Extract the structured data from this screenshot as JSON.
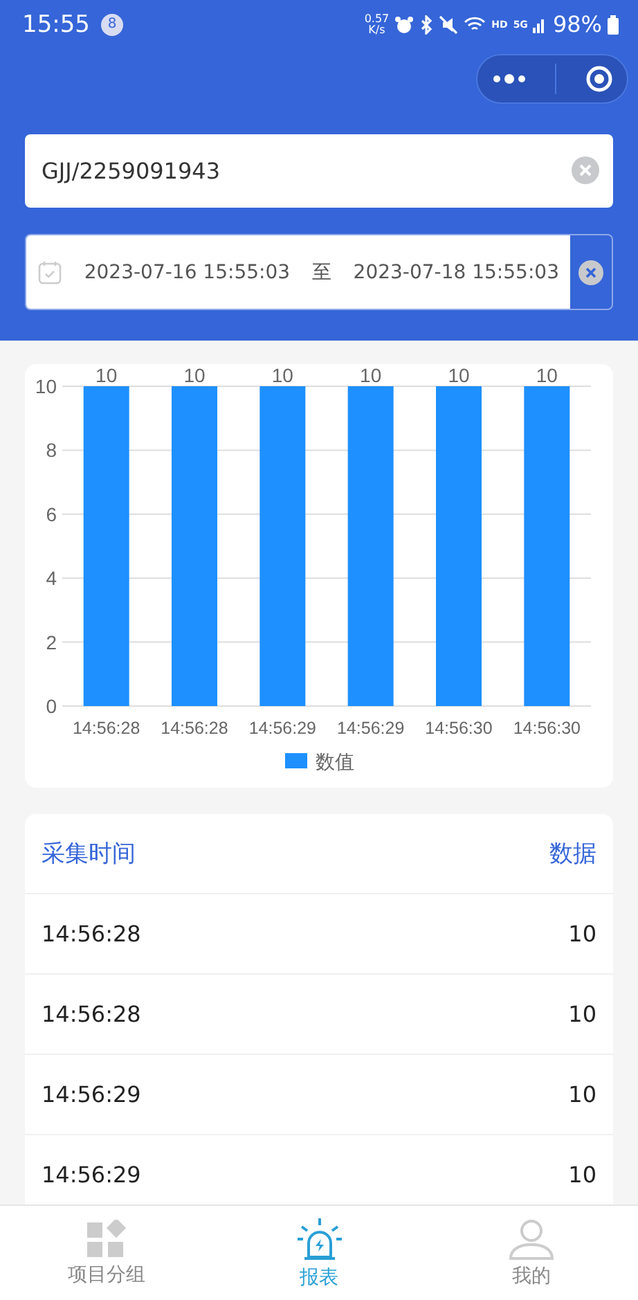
{
  "status_bar": {
    "time": "15:55",
    "notification_count": "8",
    "net_speed": "0.57",
    "net_unit": "K/s",
    "hd": "HD",
    "network": "5G",
    "battery": "98%"
  },
  "search": {
    "value": "GJJ/2259091943"
  },
  "date_range": {
    "start": "2023-07-16 15:55:03",
    "separator": "至",
    "end": "2023-07-18 15:55:03"
  },
  "chart": {
    "chart_data": {
      "type": "bar",
      "categories": [
        "14:56:28",
        "14:56:28",
        "14:56:29",
        "14:56:29",
        "14:56:30",
        "14:56:30"
      ],
      "series": [
        {
          "name": "数值",
          "color": "#1e90ff",
          "values": [
            10,
            10,
            10,
            10,
            10,
            10
          ]
        }
      ],
      "ylim": [
        0,
        10
      ],
      "yticks": [
        0,
        2,
        4,
        6,
        8,
        10
      ],
      "grid": true,
      "data_labels": true
    }
  },
  "table": {
    "columns": [
      "采集时间",
      "数据"
    ],
    "rows": [
      {
        "time": "14:56:28",
        "value": "10"
      },
      {
        "time": "14:56:28",
        "value": "10"
      },
      {
        "time": "14:56:29",
        "value": "10"
      },
      {
        "time": "14:56:29",
        "value": "10"
      }
    ]
  },
  "tab_bar": [
    {
      "label": "项目分组",
      "selected": false
    },
    {
      "label": "报表",
      "selected": true
    },
    {
      "label": "我的",
      "selected": false
    }
  ]
}
